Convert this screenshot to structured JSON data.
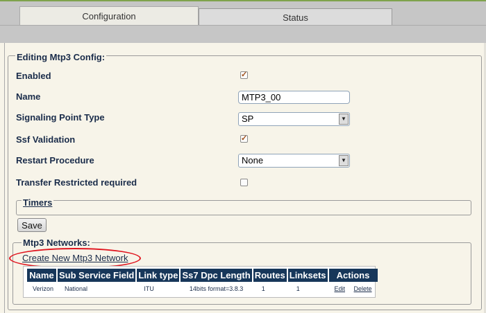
{
  "tabs": [
    {
      "label": "Configuration",
      "active": true
    },
    {
      "label": "Status",
      "active": false
    }
  ],
  "form": {
    "legend": "Editing Mtp3 Config:",
    "fields": {
      "enabled": {
        "label": "Enabled",
        "checked": true
      },
      "name": {
        "label": "Name",
        "value": "MTP3_00"
      },
      "signaling_point_type": {
        "label": "Signaling Point Type",
        "value": "SP"
      },
      "ssf_validation": {
        "label": "Ssf Validation",
        "checked": true
      },
      "restart_procedure": {
        "label": "Restart Procedure",
        "value": "None"
      },
      "transfer_restricted": {
        "label": "Transfer Restricted required",
        "checked": false
      }
    },
    "timers_legend": "Timers",
    "save_label": "Save"
  },
  "networks": {
    "legend": "Mtp3 Networks:",
    "create_link": "Create New Mtp3 Network",
    "highlight_color": "#e0141e",
    "header_color": "#17375a",
    "columns": [
      "Name",
      "Sub Service Field",
      "Link type",
      "Ss7 Dpc Length",
      "Routes",
      "Linksets",
      "Actions"
    ],
    "rows": [
      {
        "name": "Verizon",
        "ssf": "National",
        "link_type": "ITU",
        "dpc_length": "14bits format=3.8.3",
        "routes": "1",
        "linksets": "1",
        "edit": "Edit",
        "delete": "Delete"
      }
    ]
  },
  "icons": {
    "checkbox_checked": "checkmark-icon",
    "dropdown": "dropdown-arrow-icon"
  }
}
